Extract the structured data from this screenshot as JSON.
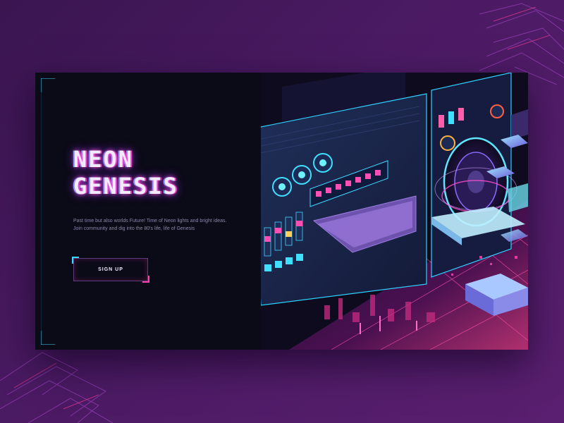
{
  "hero": {
    "title_line1": "NEON",
    "title_line2": "GENESIS",
    "tagline_line1": "Past time but also worlds Future! Time of Neon lights and bright ideas.",
    "tagline_line2": "Join community and dig into the 80's life, life of Genesis",
    "signup_label": "SIGN UP"
  },
  "illustration": {
    "subject": "isometric neon boombox with speaker, cassette deck, knobs and sliders over a glowing city grid"
  },
  "colors": {
    "background": "#4b1a63",
    "card": "#0e0c1c",
    "neon_pink": "#ff3fb0",
    "neon_cyan": "#39d7ff",
    "neon_purple": "#9d3bff"
  }
}
